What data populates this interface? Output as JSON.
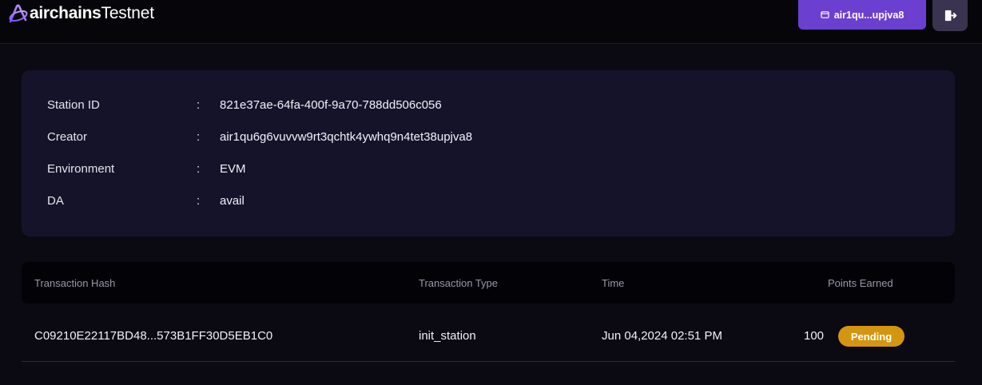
{
  "header": {
    "logo_bold": "airchains",
    "logo_regular": "Testnet",
    "wallet_label": "air1qu...upjva8",
    "logout_icon": "logout-icon"
  },
  "station": {
    "rows": [
      {
        "label": "Station ID",
        "colon": ":",
        "value": "821e37ae-64fa-400f-9a70-788dd506c056"
      },
      {
        "label": "Creator",
        "colon": ":",
        "value": "air1qu6g6vuvvw9rt3qchtk4ywhq9n4tet38upjva8"
      },
      {
        "label": "Environment",
        "colon": ":",
        "value": "EVM"
      },
      {
        "label": "DA",
        "colon": ":",
        "value": "avail"
      }
    ]
  },
  "table": {
    "columns": [
      "Transaction Hash",
      "Transaction Type",
      "Time",
      "Points Earned"
    ],
    "rows": [
      {
        "hash": "C09210E22117BD48...573B1FF30D5EB1C0",
        "type": "init_station",
        "time": "Jun 04,2024 02:51 PM",
        "points": "100",
        "status": "Pending"
      }
    ]
  },
  "colors": {
    "accent": "#6b3fd0",
    "card": "#15132a",
    "badge": "#d4960f"
  }
}
